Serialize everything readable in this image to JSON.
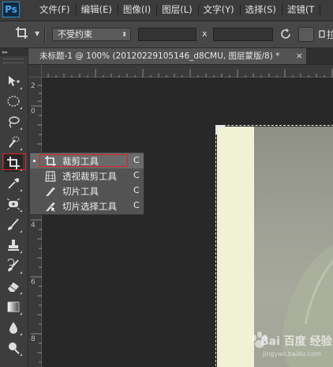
{
  "app": {
    "logo_text": "Ps"
  },
  "menubar": {
    "items": [
      {
        "label": "文件(F)"
      },
      {
        "label": "编辑(E)"
      },
      {
        "label": "图像(I)"
      },
      {
        "label": "图层(L)"
      },
      {
        "label": "文字(Y)"
      },
      {
        "label": "选择(S)"
      },
      {
        "label": "滤镜(T"
      }
    ]
  },
  "options": {
    "ratio_value": "不受约束",
    "multiply_label": "x",
    "width_value": "",
    "height_value": "",
    "straighten_label": "拉"
  },
  "document": {
    "tab_title": "未标题-1 @ 100% (20120229105146_d8CMU, 图层蒙版/8) *",
    "close_glyph": "×"
  },
  "rulers": {
    "left_labels": [
      "2",
      "0",
      "2",
      "4",
      "6",
      "8"
    ]
  },
  "tools": [
    {
      "name": "move-icon"
    },
    {
      "name": "elliptical-marquee-icon"
    },
    {
      "name": "lasso-icon"
    },
    {
      "name": "quick-selection-icon"
    },
    {
      "name": "crop-icon"
    },
    {
      "name": "eyedropper-icon"
    },
    {
      "name": "spot-healing-icon"
    },
    {
      "name": "brush-icon"
    },
    {
      "name": "clone-stamp-icon"
    },
    {
      "name": "history-brush-icon"
    },
    {
      "name": "eraser-icon"
    },
    {
      "name": "gradient-icon"
    },
    {
      "name": "blur-icon"
    },
    {
      "name": "dodge-icon"
    }
  ],
  "flyout": {
    "items": [
      {
        "label": "裁剪工具",
        "shortcut": "C",
        "icon": "crop-icon",
        "selected": true
      },
      {
        "label": "透视裁剪工具",
        "shortcut": "C",
        "icon": "perspective-crop-icon"
      },
      {
        "label": "切片工具",
        "shortcut": "C",
        "icon": "slice-icon"
      },
      {
        "label": "切片选择工具",
        "shortcut": "C",
        "icon": "slice-select-icon"
      }
    ]
  },
  "watermark": {
    "text": "Bai 百度 经验",
    "sub": "jingyan.baidu.com"
  },
  "colors": {
    "highlight_red": "#dd2222",
    "canvas_bg": "#282828",
    "doc_light": "#f1f1d5"
  }
}
